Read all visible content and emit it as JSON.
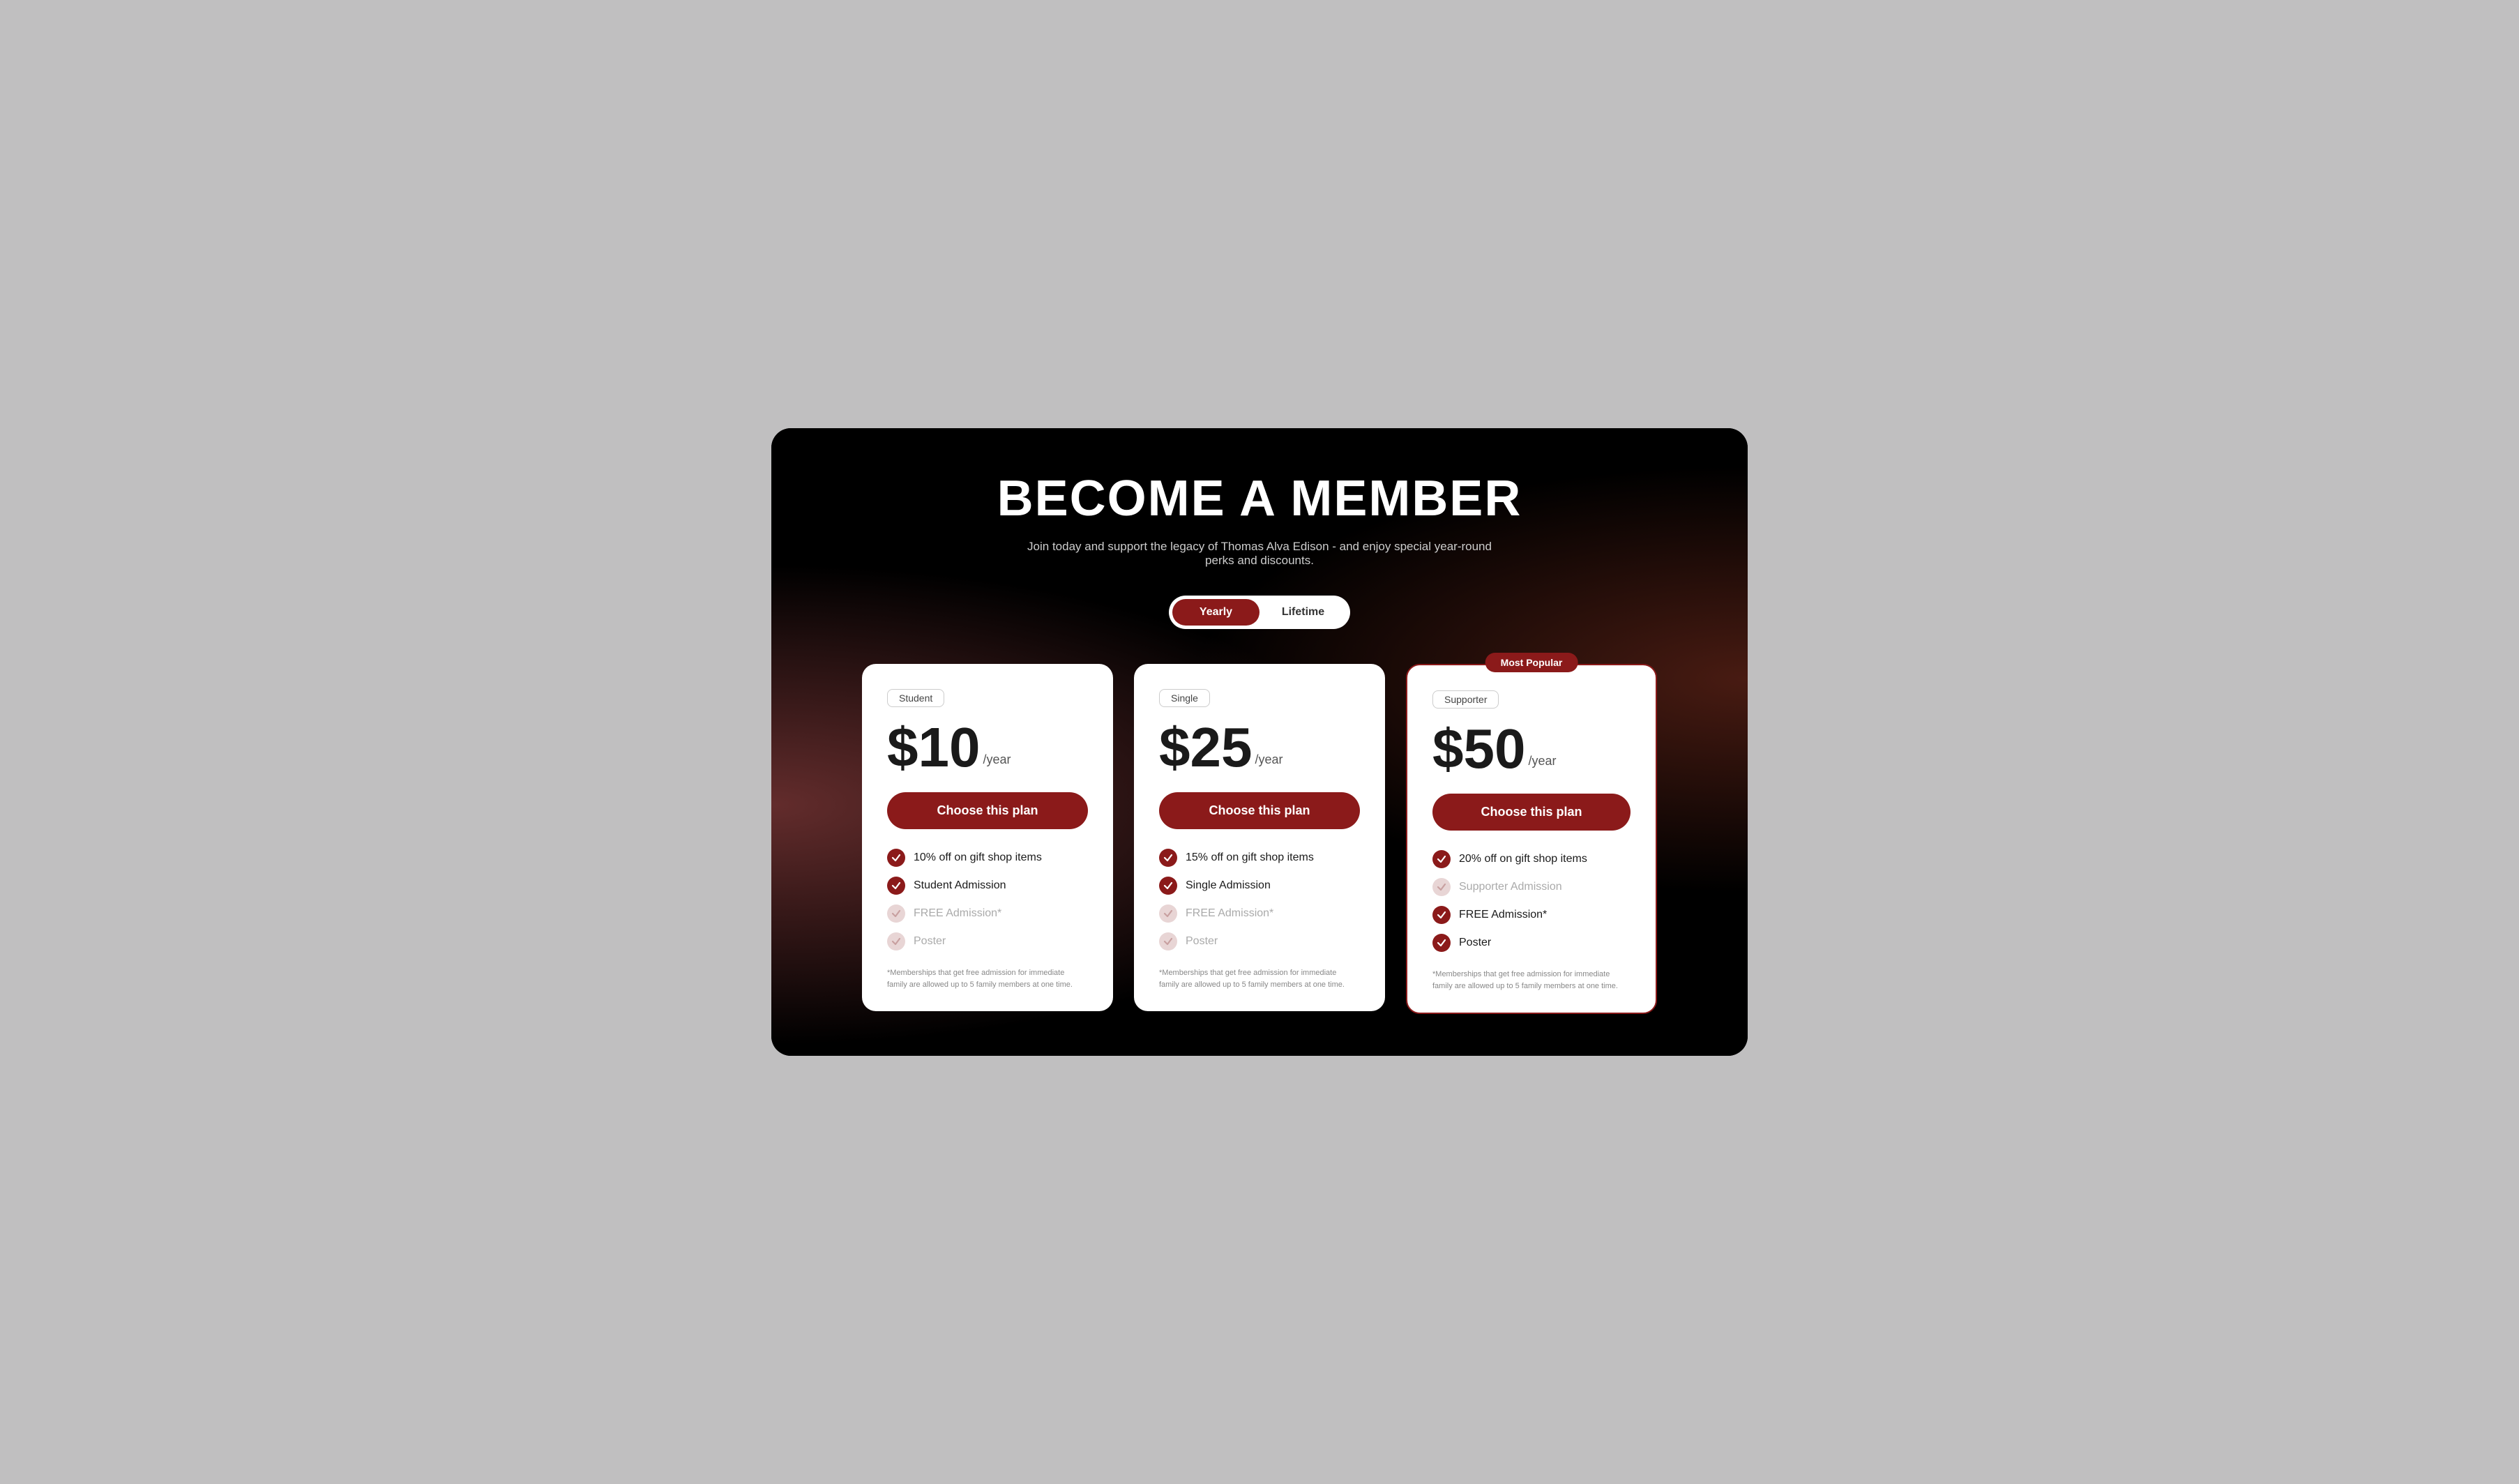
{
  "page": {
    "title": "BECOME A MEMBER",
    "subtitle": "Join today and support the legacy of Thomas Alva Edison - and enjoy special year-round perks and discounts.",
    "toggle": {
      "yearly_label": "Yearly",
      "lifetime_label": "Lifetime"
    },
    "plans": [
      {
        "id": "student",
        "tier": "Student",
        "price": "$10",
        "period": "/year",
        "cta": "Choose this plan",
        "most_popular": false,
        "features": [
          {
            "label": "10% off on gift shop items",
            "enabled": true
          },
          {
            "label": "Student Admission",
            "enabled": true
          },
          {
            "label": "FREE Admission*",
            "enabled": false
          },
          {
            "label": "Poster",
            "enabled": false
          }
        ],
        "footnote": "*Memberships that get free admission for immediate family are allowed up to 5 family members at one time."
      },
      {
        "id": "single",
        "tier": "Single",
        "price": "$25",
        "period": "/year",
        "cta": "Choose this plan",
        "most_popular": false,
        "features": [
          {
            "label": "15% off on gift shop items",
            "enabled": true
          },
          {
            "label": "Single Admission",
            "enabled": true
          },
          {
            "label": "FREE Admission*",
            "enabled": false
          },
          {
            "label": "Poster",
            "enabled": false
          }
        ],
        "footnote": "*Memberships that get free admission for immediate family are allowed up to 5 family members at one time."
      },
      {
        "id": "supporter",
        "tier": "Supporter",
        "price": "$50",
        "period": "/year",
        "cta": "Choose this plan",
        "most_popular": true,
        "most_popular_label": "Most Popular",
        "features": [
          {
            "label": "20% off on gift shop items",
            "enabled": true
          },
          {
            "label": "Supporter Admission",
            "enabled": false
          },
          {
            "label": "FREE Admission*",
            "enabled": true
          },
          {
            "label": "Poster",
            "enabled": true
          }
        ],
        "footnote": "*Memberships that get free admission for immediate family are allowed up to 5 family members at one time."
      }
    ]
  }
}
